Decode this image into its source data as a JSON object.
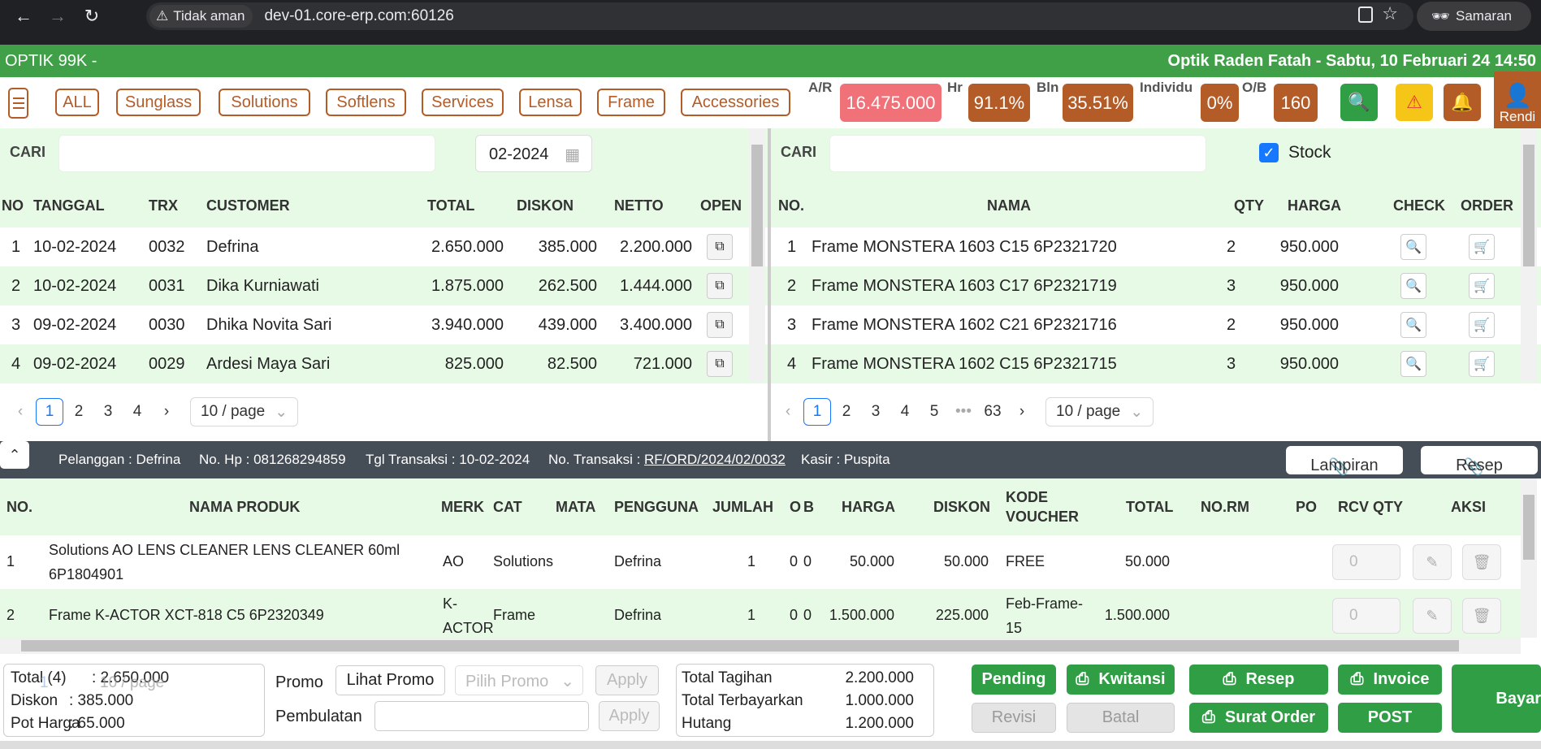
{
  "browser": {
    "security_label": "Tidak aman",
    "url": "dev-01.core-erp.com:60126",
    "profile_label": "Samaran"
  },
  "app": {
    "brand": "OPTIK 99K -",
    "store_info": "Optik Raden Fatah - Sabtu, 10 Februari 24 14:50"
  },
  "categories": [
    "ALL",
    "Sunglass",
    "Solutions",
    "Softlens",
    "Services",
    "Lensa",
    "Frame",
    "Accessories"
  ],
  "stats": {
    "ar_label": "A/R",
    "ar_value": "16.475.000",
    "hr_label": "Hr",
    "hr_value": "91.1%",
    "bln_label": "Bln",
    "bln_value": "35.51%",
    "individu_label": "Individu",
    "individu_value": "0%",
    "ob_label": "O/B",
    "ob_value": "160"
  },
  "user": {
    "name": "Rendi"
  },
  "left_panel": {
    "search_label": "CARI",
    "month_value": "02-2024",
    "headers": {
      "no": "NO",
      "tanggal": "TANGGAL",
      "trx": "TRX",
      "customer": "CUSTOMER",
      "total": "TOTAL",
      "diskon": "DISKON",
      "netto": "NETTO",
      "open": "OPEN"
    },
    "rows": [
      {
        "no": "1",
        "tanggal": "10-02-2024",
        "trx": "0032",
        "customer": "Defrina",
        "total": "2.650.000",
        "diskon": "385.000",
        "netto": "2.200.000"
      },
      {
        "no": "2",
        "tanggal": "10-02-2024",
        "trx": "0031",
        "customer": "Dika Kurniawati",
        "total": "1.875.000",
        "diskon": "262.500",
        "netto": "1.444.000"
      },
      {
        "no": "3",
        "tanggal": "09-02-2024",
        "trx": "0030",
        "customer": "Dhika Novita Sari",
        "total": "3.940.000",
        "diskon": "439.000",
        "netto": "3.400.000"
      },
      {
        "no": "4",
        "tanggal": "09-02-2024",
        "trx": "0029",
        "customer": "Ardesi Maya Sari",
        "total": "825.000",
        "diskon": "82.500",
        "netto": "721.000"
      }
    ],
    "pages": [
      "1",
      "2",
      "3",
      "4"
    ],
    "page_size": "10 / page"
  },
  "right_panel": {
    "search_label": "CARI",
    "stock_label": "Stock",
    "stock_checked": true,
    "headers": {
      "no": "NO.",
      "nama": "NAMA",
      "qty": "QTY",
      "harga": "HARGA",
      "check": "CHECK",
      "order": "ORDER"
    },
    "rows": [
      {
        "no": "1",
        "nama": "Frame MONSTERA 1603 C15 6P2321720",
        "qty": "2",
        "harga": "950.000"
      },
      {
        "no": "2",
        "nama": "Frame MONSTERA 1603 C17 6P2321719",
        "qty": "3",
        "harga": "950.000"
      },
      {
        "no": "3",
        "nama": "Frame MONSTERA 1602 C21 6P2321716",
        "qty": "2",
        "harga": "950.000"
      },
      {
        "no": "4",
        "nama": "Frame MONSTERA 1602 C15 6P2321715",
        "qty": "3",
        "harga": "950.000"
      }
    ],
    "pages": [
      "1",
      "2",
      "3",
      "4",
      "5",
      "•••",
      "63"
    ],
    "page_size": "10 / page"
  },
  "info_bar": {
    "pelanggan": "Pelanggan : Defrina",
    "hp": "No. Hp : 081268294859",
    "tgl": "Tgl Transaksi : 10-02-2024",
    "no_trx_label": "No. Transaksi :",
    "no_trx_value": "RF/ORD/2024/02/0032",
    "kasir": "Kasir : Puspita",
    "lampiran": "Lampiran",
    "resep": "Resep"
  },
  "detail": {
    "headers": {
      "no": "NO.",
      "nama": "NAMA PRODUK",
      "merk": "MERK",
      "cat": "CAT",
      "mata": "MATA",
      "pengguna": "PENGGUNA",
      "jumlah": "JUMLAH",
      "o": "O",
      "b": "B",
      "harga": "HARGA",
      "diskon": "DISKON",
      "kode1": "KODE",
      "kode2": "VOUCHER",
      "total": "TOTAL",
      "norm": "NO.RM",
      "po": "PO",
      "rcv": "RCV QTY",
      "aksi": "AKSI"
    },
    "rows": [
      {
        "no": "1",
        "nama1": "Solutions AO LENS CLEANER LENS CLEANER 60ml",
        "nama2": "6P1804901",
        "merk1": "AO",
        "merk2": "",
        "cat": "Solutions",
        "pengguna": "Defrina",
        "jumlah": "1",
        "o": "0",
        "b": "0",
        "harga": "50.000",
        "diskon": "50.000",
        "kode1": "FREE",
        "kode2": "",
        "total": "50.000",
        "rcv": "0"
      },
      {
        "no": "2",
        "nama1": "Frame K-ACTOR XCT-818 C5 6P2320349",
        "nama2": "",
        "merk1": "K-",
        "merk2": "ACTOR",
        "cat": "Frame",
        "pengguna": "Defrina",
        "jumlah": "1",
        "o": "0",
        "b": "0",
        "harga": "1.500.000",
        "diskon": "225.000",
        "kode1": "Feb-Frame-",
        "kode2": "15",
        "total": "1.500.000",
        "rcv": "0"
      }
    ]
  },
  "footer": {
    "total_label": "Total (4)",
    "total_value": ": 2.650.000",
    "diskon_label": "Diskon",
    "diskon_value": ":  385.000",
    "pot_label": "Pot Harga",
    "pot_value": ":  65.000",
    "overlay_page": "1",
    "overlay_size": "10 / page",
    "promo_label": "Promo",
    "lihat_promo": "Lihat Promo",
    "pilih_promo": "Pilih Promo",
    "apply": "Apply",
    "pembulatan_label": "Pembulatan",
    "tagihan_label": "Total Tagihan",
    "tagihan_value": "2.200.000",
    "terbayar_label": "Total Terbayarkan",
    "terbayar_value": "1.000.000",
    "hutang_label": "Hutang",
    "hutang_value": "1.200.000",
    "pending": "Pending",
    "kwitansi": "Kwitansi",
    "resep": "Resep",
    "invoice": "Invoice",
    "revisi": "Revisi",
    "batal": "Batal",
    "surat_order": "Surat Order",
    "post": "POST",
    "bayar": "Bayar"
  },
  "colors": {
    "green": "#3fa048",
    "brown": "#b35c28",
    "pink": "#f07178",
    "light_green": "#e6fae6",
    "button_green": "#2f9e44"
  }
}
